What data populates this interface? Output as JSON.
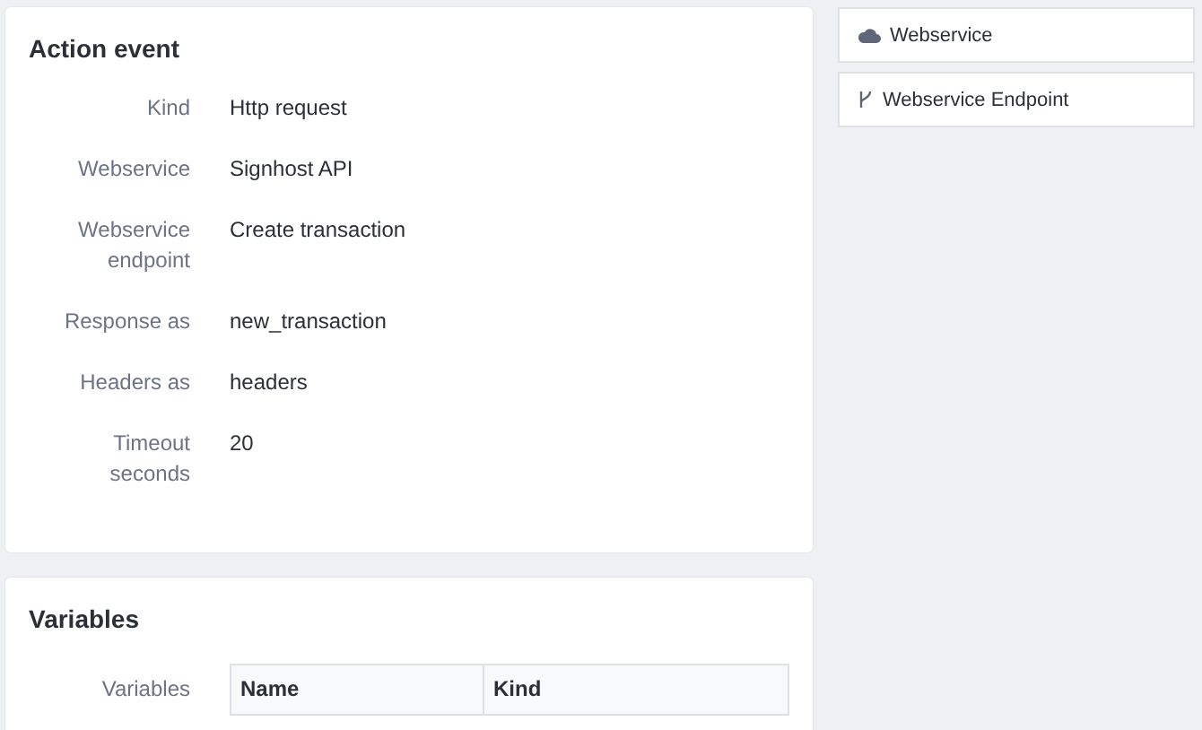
{
  "action_event": {
    "title": "Action event",
    "fields": [
      {
        "label": "Kind",
        "value": "Http request"
      },
      {
        "label": "Webservice",
        "value": "Signhost API"
      },
      {
        "label": "Webservice endpoint",
        "value": "Create transaction"
      },
      {
        "label": "Response as",
        "value": "new_transaction"
      },
      {
        "label": "Headers as",
        "value": "headers"
      },
      {
        "label": "Timeout seconds",
        "value": "20"
      }
    ]
  },
  "variables": {
    "title": "Variables",
    "label": "Variables",
    "table": {
      "columns": [
        "Name",
        "Kind"
      ]
    }
  },
  "sidebar": {
    "items": [
      {
        "label": "Webservice",
        "kind": "cloud"
      },
      {
        "label": "Webservice Endpoint",
        "kind": "branch"
      }
    ]
  }
}
